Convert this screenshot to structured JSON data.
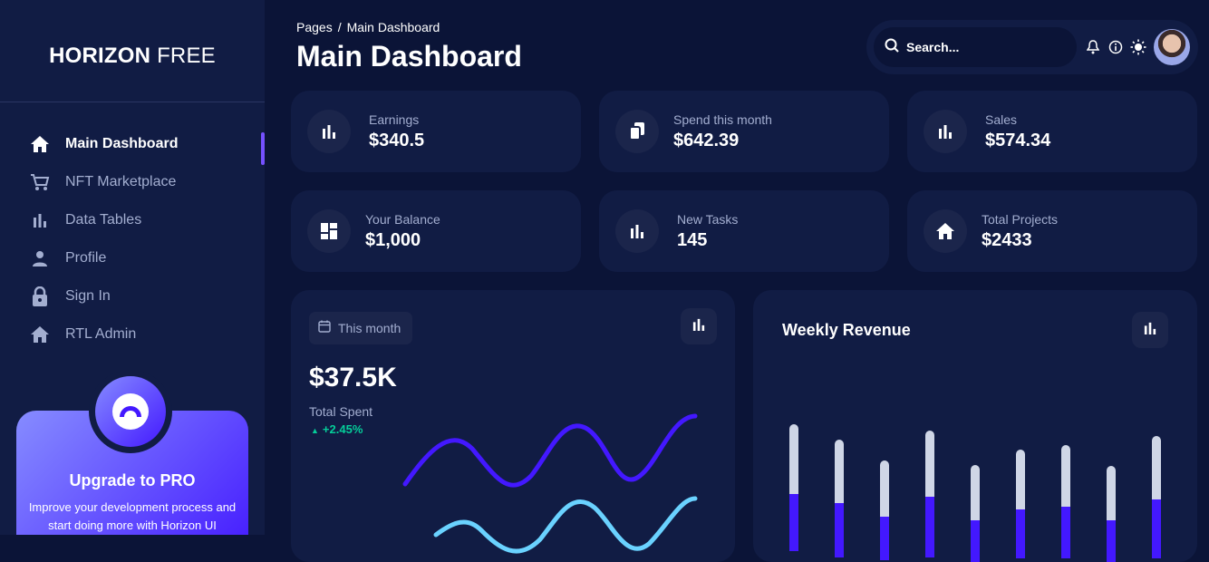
{
  "brand": {
    "bold": "HORIZON",
    "light": "FREE"
  },
  "sidebar": {
    "items": [
      {
        "label": "Main Dashboard",
        "icon": "home-icon",
        "active": true
      },
      {
        "label": "NFT Marketplace",
        "icon": "cart-icon",
        "active": false
      },
      {
        "label": "Data Tables",
        "icon": "bar-chart-icon",
        "active": false
      },
      {
        "label": "Profile",
        "icon": "person-icon",
        "active": false
      },
      {
        "label": "Sign In",
        "icon": "lock-icon",
        "active": false
      },
      {
        "label": "RTL Admin",
        "icon": "home-icon",
        "active": false
      }
    ],
    "promo": {
      "title": "Upgrade to PRO",
      "text": "Improve your development process and start doing more with Horizon UI"
    }
  },
  "header": {
    "breadcrumb": {
      "root": "Pages",
      "separator": "/",
      "current": "Main Dashboard"
    },
    "title": "Main Dashboard",
    "search_placeholder": "Search..."
  },
  "stats": [
    {
      "label": "Earnings",
      "value": "$340.5",
      "icon": "bar-chart-icon"
    },
    {
      "label": "Spend this month",
      "value": "$642.39",
      "icon": "documents-icon"
    },
    {
      "label": "Sales",
      "value": "$574.34",
      "icon": "bar-chart-icon"
    },
    {
      "label": "Your Balance",
      "value": "$1,000",
      "icon": "dashboard-icon"
    },
    {
      "label": "New Tasks",
      "value": "145",
      "icon": "bar-chart-icon"
    },
    {
      "label": "Total Projects",
      "value": "$2433",
      "icon": "home-icon"
    }
  ],
  "spent_card": {
    "period": "This month",
    "total": "$37.5K",
    "total_label": "Total Spent",
    "growth": "+2.45%"
  },
  "revenue_card": {
    "title": "Weekly Revenue"
  },
  "colors": {
    "background": "#0b1437",
    "card": "#111c44",
    "accent": "#7551ff",
    "brand": "#4318ff",
    "line_secondary": "#6ad2ff",
    "bar_track": "#cfd6e6",
    "growth": "#05cd99"
  }
}
